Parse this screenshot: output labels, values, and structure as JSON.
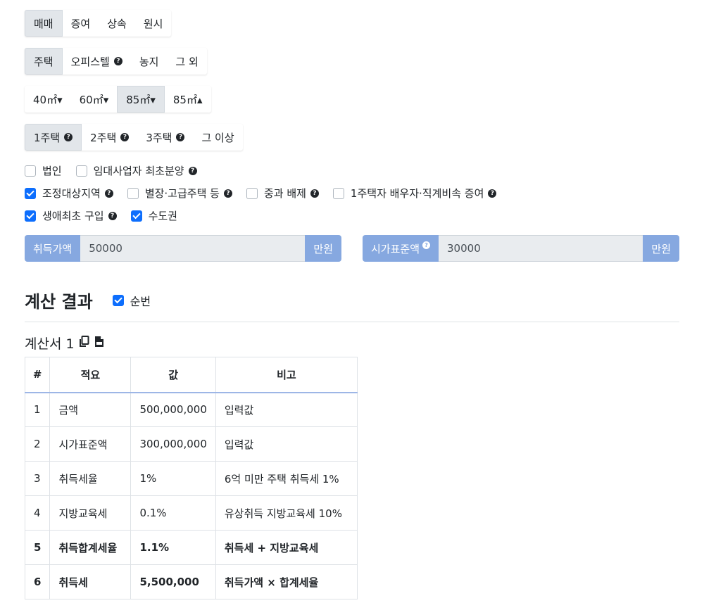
{
  "trade_types": [
    "매매",
    "증여",
    "상속",
    "원시"
  ],
  "property_types": [
    "주택",
    "오피스텔",
    "농지",
    "그 외"
  ],
  "area_types": [
    "40㎡▾",
    "60㎡▾",
    "85㎡▾",
    "85㎡▴"
  ],
  "house_counts": [
    "1주택",
    "2주택",
    "3주택",
    "그 이상"
  ],
  "checks_row1": [
    "법인",
    "임대사업자 최초분양"
  ],
  "checks_row2": [
    "조정대상지역",
    "별장·고급주택 등",
    "중과 배제",
    "1주택자 배우자·직계비속 증여"
  ],
  "checks_row3": [
    "생애최초 구입",
    "수도권"
  ],
  "acquisition_price": {
    "label": "취득가액",
    "value": "50000",
    "unit": "만원"
  },
  "standard_price": {
    "label": "시가표준액",
    "value": "30000",
    "unit": "만원"
  },
  "result": {
    "title": "계산 결과",
    "order_label": "순번"
  },
  "sheet": {
    "title": "계산서 1"
  },
  "table": {
    "headers": [
      "#",
      "적요",
      "값",
      "비고"
    ],
    "rows": [
      [
        "1",
        "금액",
        "500,000,000",
        "입력값"
      ],
      [
        "2",
        "시가표준액",
        "300,000,000",
        "입력값"
      ],
      [
        "3",
        "취득세율",
        "1%",
        "6억 미만 주택 취득세 1%"
      ],
      [
        "4",
        "지방교육세",
        "0.1%",
        "유상취득 지방교육세 10%"
      ],
      [
        "5",
        "취득합계세율",
        "1.1%",
        "취득세 + 지방교육세"
      ],
      [
        "6",
        "취득세",
        "5,500,000",
        "취득가액 × 합계세율"
      ]
    ]
  }
}
